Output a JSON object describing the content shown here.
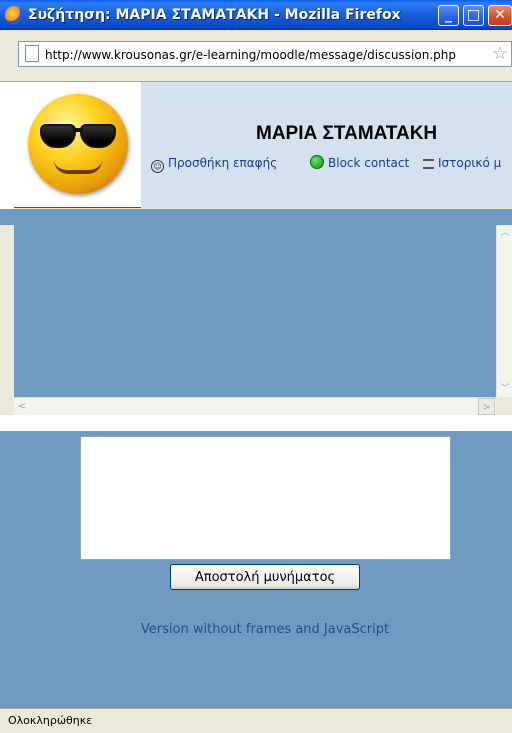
{
  "window": {
    "title": "Συζήτηση: ΜΑΡΙΑ ΣΤΑΜΑΤΑΚΗ - Mozilla Firefox",
    "minimize_label": "_",
    "maximize_label": "□",
    "close_label": "✕"
  },
  "address_bar": {
    "url": "http://www.krousonas.gr/e-learning/moodle/message/discussion.php"
  },
  "header": {
    "contact_name": "ΜΑΡΙΑ ΣΤΑΜΑΤΑΚΗ",
    "links": {
      "add_contact": "Προσθήκη επαφής",
      "block_contact": "Block contact",
      "history": "Ιστορικό μ"
    }
  },
  "icons": {
    "avatar": "smiley-sunglasses-icon",
    "add_contact": "add-contact-icon",
    "block_contact": "green-circle-icon",
    "history": "history-icon",
    "bookmark": "star-icon",
    "page": "page-icon"
  },
  "send_form": {
    "message_value": "",
    "send_label": "Αποστολή μυνήματος",
    "noframes_link": "Version without frames and JavaScript"
  },
  "status_bar": {
    "text": "Ολοκληρώθηκε"
  },
  "colors": {
    "frame_background": "#6f9bc3",
    "header_background": "#d3e2ee",
    "titlebar": "#0f4fd0",
    "link": "#1f4e86"
  }
}
